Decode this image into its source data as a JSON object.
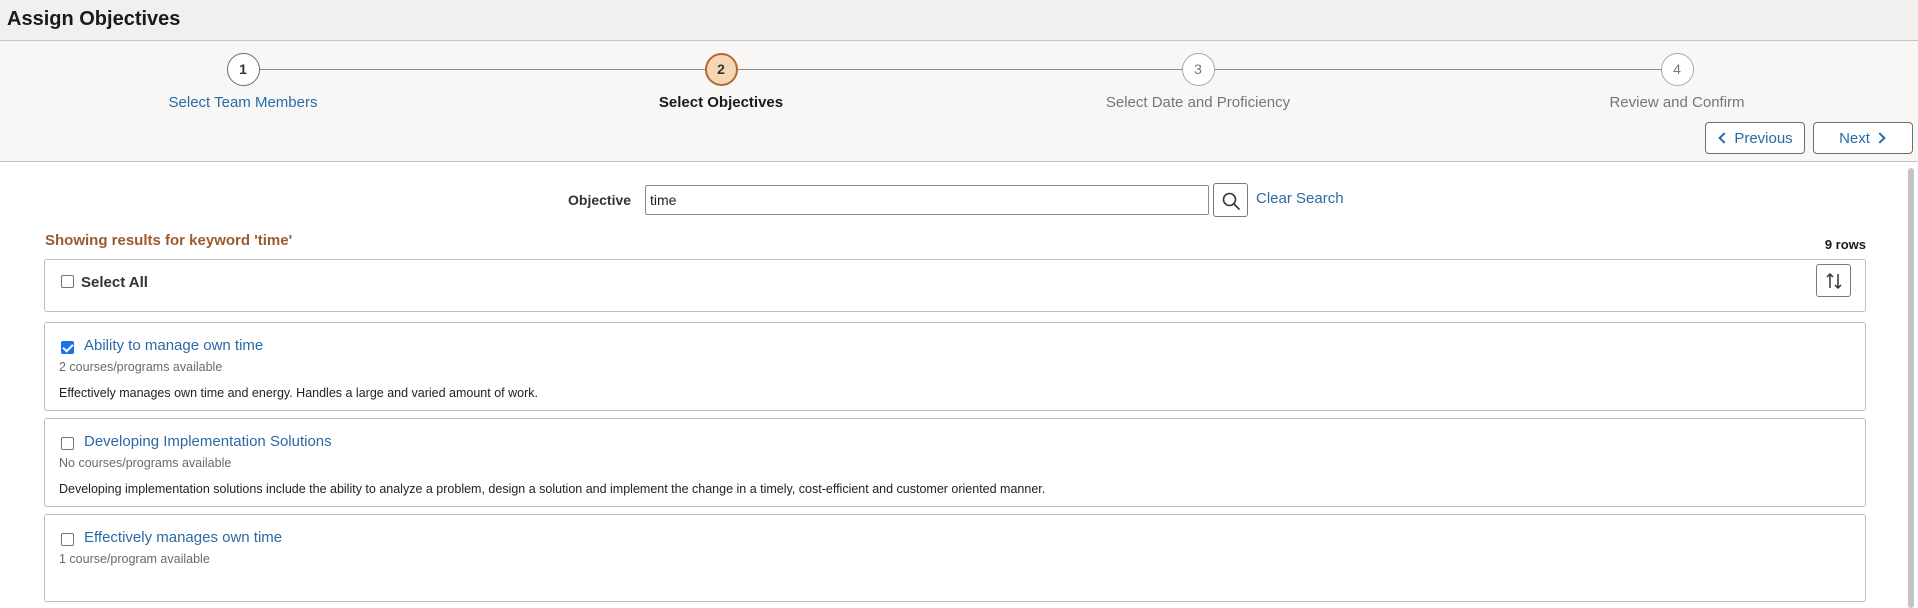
{
  "header": {
    "title": "Assign Objectives"
  },
  "train": {
    "steps": [
      {
        "number": "1",
        "label": "Select Team Members"
      },
      {
        "number": "2",
        "label": "Select Objectives"
      },
      {
        "number": "3",
        "label": "Select Date and Proficiency"
      },
      {
        "number": "4",
        "label": "Review and Confirm"
      }
    ],
    "current_step": 2
  },
  "nav": {
    "previous_label": "Previous",
    "next_label": "Next"
  },
  "search": {
    "label": "Objective",
    "value": "time",
    "search_icon": "search-icon",
    "clear_label": "Clear Search"
  },
  "results": {
    "message": "Showing results for keyword 'time'",
    "row_count": "9 rows"
  },
  "list": {
    "select_all_label": "Select All",
    "sort_icon": "sort-icon",
    "items": [
      {
        "title": "Ability to manage own time",
        "availability": "2 courses/programs available",
        "description": "Effectively manages own time and energy.  Handles a large and varied amount of work.",
        "checked": true
      },
      {
        "title": "Developing Implementation Solutions",
        "availability": "No courses/programs available",
        "description": "Developing implementation solutions include the ability to analyze a problem, design a solution and implement the change in a timely, cost-efficient and customer oriented manner.",
        "checked": false
      },
      {
        "title": "Effectively manages own time",
        "availability": "1 course/program available",
        "description": "",
        "checked": false
      }
    ]
  },
  "colors": {
    "link": "#2a6aa5",
    "active_step_fill": "#f5d6b5",
    "active_step_border": "#b06a2f",
    "results_message": "#9c5a2e",
    "checkbox_checked": "#1a73e8"
  }
}
